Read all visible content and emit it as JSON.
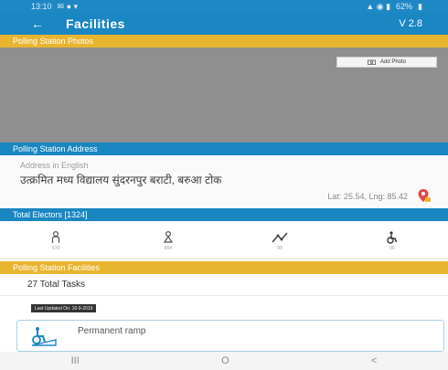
{
  "status_bar": {
    "time": "13:10",
    "battery": "62%"
  },
  "app_bar": {
    "back_icon": "back-arrow-icon",
    "title": "Facilities",
    "version": "V 2.8"
  },
  "sections": {
    "photos": "Polling Station Photos",
    "address": "Polling Station Address",
    "electors": "Total Electors [1324]",
    "facilities": "Polling Station Facilities"
  },
  "photos": {
    "add_label": "Add Photo"
  },
  "address": {
    "english_label": "Address in English",
    "hindi_address": "उत्क्रमित मध्य विद्यालय सुंदरनपुर बराटी, बरुआ टोक",
    "latlng": "Lat: 25.54, Lng: 85.42"
  },
  "electors": [
    {
      "icon": "male-icon",
      "count": "670"
    },
    {
      "icon": "female-icon",
      "count": "654"
    },
    {
      "icon": "third-gender-icon",
      "count": "00"
    },
    {
      "icon": "disabled-person-icon",
      "count": "00"
    }
  ],
  "facilities": {
    "total_tasks": "27 Total Tasks",
    "last_updated": "Last Updated On: 16-9-2019",
    "items": [
      {
        "icon": "wheelchair-ramp-icon",
        "label": "Permanent ramp"
      }
    ]
  },
  "nav": {
    "recents": "III",
    "home": "O",
    "back": "<"
  },
  "colors": {
    "primary": "#1a86c2",
    "accent": "#e8b530"
  }
}
